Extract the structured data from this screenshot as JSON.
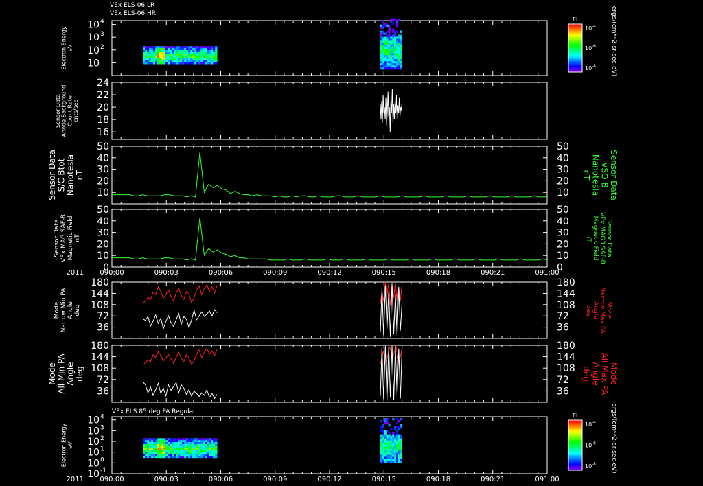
{
  "header": {
    "line1": "VEx ELS-06 LR",
    "line2": "VEx ELS-06 HR"
  },
  "date_label": "2011",
  "colors": {
    "background": "#000000",
    "axes": "#ffffff",
    "mag": "#33ff33",
    "red": "#ff2020",
    "white": "#ffffff"
  },
  "chart_data": [
    {
      "type": "heatmap",
      "panel": "energy-top",
      "ylabel": [
        "Electron Energy",
        "eV"
      ],
      "yticks": [
        {
          "base": "10",
          "exp": "4",
          "value": 10000
        },
        {
          "base": "10",
          "exp": "3",
          "value": 1000
        },
        {
          "base": "10",
          "exp": "2",
          "value": 100
        },
        {
          "base": "10",
          "exp": "",
          "value": 10
        }
      ],
      "ylim": [
        1,
        20000
      ],
      "yscale": "log",
      "colorbar": {
        "title": "El",
        "ticks": [
          {
            "base": "10",
            "exp": "-4"
          },
          {
            "base": "10",
            "exp": "-6"
          },
          {
            "base": "10",
            "exp": "-8"
          }
        ],
        "unit": "ergs/(cm**2-sr-sec-eV)"
      },
      "blocks": [
        {
          "x": [
            "09:02:08",
            "09:07:15"
          ],
          "energy_range": [
            8,
            200
          ]
        },
        {
          "x": [
            "09:18:30",
            "09:20:00"
          ],
          "energy_range": [
            3,
            30000
          ]
        }
      ]
    },
    {
      "type": "line",
      "panel": "background",
      "ylabel": [
        "Sensor Data",
        "Anode Background",
        "Count Rate",
        "cnts/sec"
      ],
      "yticks": [
        "24",
        "22",
        "20",
        "18",
        "16"
      ],
      "ylim": [
        14.8,
        24
      ],
      "series": [
        {
          "x_range": [
            "09:18:30",
            "09:20:00"
          ],
          "values": [
            20.5,
            18,
            21,
            17.5,
            22,
            19,
            20,
            18,
            21.5,
            17,
            19.5,
            22.5,
            18.5,
            20,
            16,
            21,
            19,
            23,
            17.5,
            20.5,
            18,
            21,
            19,
            22,
            17.8,
            20.3,
            19,
            21.5,
            18.5,
            20,
            19.5,
            21
          ]
        }
      ]
    },
    {
      "type": "line",
      "panel": "sc-btot",
      "ylabel": [
        "Sensor Data",
        "S/C Btot",
        "Nanotesla",
        "nT"
      ],
      "ylabel_right": [
        "Sensor Data",
        "VSO B",
        "Nanotesla",
        "nT"
      ],
      "yticks": [
        "50",
        "40",
        "30",
        "20",
        "10"
      ],
      "ylim": [
        0,
        50
      ],
      "series": [
        {
          "x_range": [
            "09:00:00",
            "09:30:00"
          ],
          "values": [
            8,
            8,
            8,
            8,
            8,
            7,
            7,
            8,
            7,
            7,
            7,
            7,
            8,
            8,
            7,
            7,
            7,
            6,
            7,
            6,
            45,
            10,
            17,
            14,
            16,
            13,
            12,
            9,
            11,
            9,
            8,
            8,
            7,
            8,
            7,
            7,
            7,
            6,
            7,
            6,
            6,
            7,
            6,
            7,
            7,
            6,
            6,
            7,
            6,
            6,
            6,
            7,
            7,
            6,
            6,
            6,
            7,
            6,
            6,
            6,
            6,
            7,
            6,
            6,
            6,
            6,
            7,
            6,
            6,
            6,
            6,
            7,
            6,
            6,
            6,
            6,
            7,
            6,
            6,
            6,
            6,
            7,
            6,
            6,
            6,
            6,
            7,
            6,
            6,
            6,
            6,
            7,
            6,
            6,
            6,
            6,
            7,
            6,
            6,
            6
          ]
        }
      ]
    },
    {
      "type": "line",
      "panel": "mag-saf",
      "ylabel": [
        "Sensor Data",
        "VEx MAG SAF-B",
        "Magnetic Field",
        "nT"
      ],
      "ylabel_right": [
        "Sensor Data",
        "VEx MAG3 SAF-B",
        "Magnetic Field",
        "nT"
      ],
      "yticks": [
        "50",
        "40",
        "30",
        "20",
        "10",
        "0"
      ],
      "ylim": [
        0,
        50
      ],
      "series": [
        {
          "x_range": [
            "09:00:00",
            "09:30:00"
          ],
          "values": [
            8,
            8,
            8,
            8,
            8,
            7,
            7,
            8,
            7,
            7,
            7,
            7,
            8,
            8,
            7,
            7,
            7,
            6,
            7,
            6,
            43,
            10,
            16,
            13,
            15,
            12,
            11,
            9,
            10,
            8,
            8,
            7,
            7,
            7,
            7,
            7,
            6,
            6,
            6,
            6,
            7,
            6,
            6,
            6,
            7,
            6,
            6,
            6,
            6,
            7,
            6,
            6,
            6,
            7,
            6,
            6,
            6,
            6,
            7,
            6,
            6,
            6,
            6,
            7,
            6,
            6,
            6,
            6,
            7,
            6,
            6,
            6,
            6,
            7,
            6,
            6,
            6,
            6,
            7,
            6,
            6,
            6,
            6,
            7,
            6,
            6,
            6,
            6,
            7,
            6,
            6,
            6,
            6,
            7,
            6,
            6,
            6,
            6,
            7,
            6
          ]
        }
      ]
    },
    {
      "type": "line",
      "panel": "narrow-pa",
      "ylabel": [
        "Mode",
        "Narrow Min PA",
        "Angle",
        "deg"
      ],
      "ylabel_right": [
        "Mode",
        "Narrow Max PA",
        "Angle",
        "deg"
      ],
      "yticks": [
        "180",
        "144",
        "108",
        "72",
        "36"
      ],
      "ylim": [
        0,
        180
      ],
      "series": [
        {
          "color": "red",
          "x_range": [
            "09:02:08",
            "09:07:15"
          ],
          "values": [
            112,
            120,
            132,
            125,
            148,
            140,
            165,
            150,
            128,
            140,
            155,
            135,
            120,
            145,
            160,
            138,
            125,
            150,
            142,
            115,
            130,
            155,
            168,
            140,
            160,
            172,
            150,
            165,
            145,
            170
          ]
        },
        {
          "color": "white",
          "x_range": [
            "09:02:08",
            "09:07:15"
          ],
          "values": [
            62,
            58,
            70,
            40,
            55,
            75,
            48,
            65,
            30,
            55,
            72,
            50,
            38,
            60,
            80,
            45,
            70,
            62,
            35,
            58,
            90,
            60,
            72,
            85,
            70,
            78,
            88,
            72,
            92,
            82
          ]
        },
        {
          "color": "red",
          "x_range": [
            "09:18:30",
            "09:20:00"
          ],
          "values": [
            110,
            150,
            120,
            180,
            140,
            175,
            105,
            170,
            130,
            180,
            115,
            160,
            120,
            178
          ]
        },
        {
          "color": "white",
          "x_range": [
            "09:18:30",
            "09:20:00"
          ],
          "values": [
            20,
            160,
            10,
            170,
            30,
            150,
            5,
            175,
            15,
            140,
            8,
            165,
            25,
            120
          ]
        }
      ]
    },
    {
      "type": "line",
      "panel": "all-pa",
      "ylabel": [
        "Mode",
        "All Min PA",
        "Angle",
        "deg"
      ],
      "ylabel_right": [
        "Mode",
        "All Max PA",
        "Angle",
        "deg"
      ],
      "yticks": [
        "180",
        "144",
        "108",
        "72",
        "36"
      ],
      "ylim": [
        0,
        180
      ],
      "series": [
        {
          "color": "red",
          "x_range": [
            "09:02:08",
            "09:07:15"
          ],
          "values": [
            118,
            125,
            135,
            128,
            150,
            142,
            160,
            148,
            130,
            140,
            152,
            136,
            122,
            142,
            158,
            140,
            128,
            150,
            140,
            120,
            132,
            152,
            165,
            140,
            158,
            170,
            152,
            162,
            148,
            168
          ]
        },
        {
          "color": "white",
          "x_range": [
            "09:02:08",
            "09:07:15"
          ],
          "values": [
            65,
            55,
            30,
            48,
            22,
            40,
            60,
            28,
            45,
            20,
            55,
            38,
            50,
            62,
            30,
            55,
            45,
            25,
            40,
            20,
            35,
            28,
            18,
            30,
            22,
            40,
            15,
            28,
            12,
            25
          ]
        },
        {
          "color": "red",
          "x_range": [
            "09:18:30",
            "09:20:00"
          ],
          "values": [
            120,
            160,
            130,
            175,
            140,
            178,
            125,
            170
          ]
        },
        {
          "color": "white",
          "x_range": [
            "09:18:30",
            "09:20:00"
          ],
          "values": [
            20,
            175,
            10,
            178,
            5,
            176,
            15,
            178,
            8,
            175,
            20,
            170,
            12,
            176
          ]
        }
      ]
    },
    {
      "type": "heatmap",
      "panel": "energy-bottom",
      "title": "VEx ELS 85 deg PA Regular",
      "ylabel": [
        "Electron Energy",
        "eV"
      ],
      "yticks": [
        {
          "base": "10",
          "exp": "4",
          "value": 10000
        },
        {
          "base": "10",
          "exp": "3",
          "value": 1000
        },
        {
          "base": "10",
          "exp": "2",
          "value": 100
        },
        {
          "base": "10",
          "exp": "1",
          "value": 10
        },
        {
          "base": "10",
          "exp": "0",
          "value": 1
        },
        {
          "base": "10",
          "exp": "-1",
          "value": 0.1
        }
      ],
      "ylim": [
        0.1,
        20000
      ],
      "yscale": "log",
      "colorbar": {
        "title": "El",
        "ticks": [
          {
            "base": "10",
            "exp": "-4"
          },
          {
            "base": "10",
            "exp": "-6"
          },
          {
            "base": "10",
            "exp": "-8"
          }
        ],
        "unit": "ergs/(cm**2-sr-sec-eV)"
      },
      "blocks": [
        {
          "x": [
            "09:02:08",
            "09:07:15"
          ],
          "energy_range": [
            3,
            200
          ]
        },
        {
          "x": [
            "09:18:30",
            "09:20:00"
          ],
          "energy_range": [
            1,
            15000
          ]
        }
      ]
    }
  ],
  "xaxis": {
    "range": [
      "09:00:00",
      "09:30:00"
    ],
    "ticks": [
      "090:00",
      "090:03",
      "090:06",
      "090:09",
      "090:12",
      "090:15",
      "090:18",
      "090:21",
      "091:00"
    ]
  }
}
